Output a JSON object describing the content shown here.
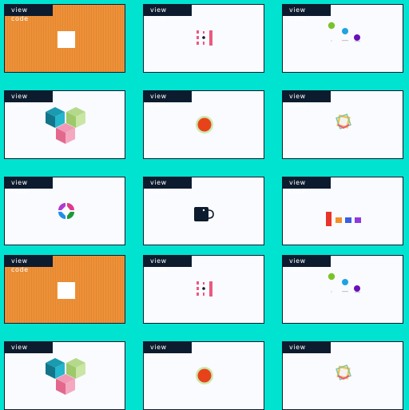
{
  "cards": [
    {
      "label": "view code",
      "art": "square-on-orange-icon",
      "background": "#ee9037"
    },
    {
      "label": "view code",
      "art": "pink-bars-icon"
    },
    {
      "label": "view code",
      "art": "bouncing-dots-icon"
    },
    {
      "label": "view code",
      "art": "cubes-icon"
    },
    {
      "label": "view code",
      "art": "pulsing-circle-icon"
    },
    {
      "label": "view code",
      "art": "rotating-square-icon"
    },
    {
      "label": "view code",
      "art": "four-circles-icon"
    },
    {
      "label": "view code",
      "art": "mug-icon"
    },
    {
      "label": "view code",
      "art": "color-blocks-icon"
    },
    {
      "label": "view code",
      "art": "square-on-orange-icon",
      "background": "#ee9037"
    },
    {
      "label": "view code",
      "art": "pink-bars-icon"
    },
    {
      "label": "view code",
      "art": "bouncing-dots-icon"
    },
    {
      "label": "view code",
      "art": "cubes-icon"
    },
    {
      "label": "view code",
      "art": "pulsing-circle-icon"
    },
    {
      "label": "view code",
      "art": "rotating-square-icon"
    }
  ],
  "colors": {
    "page_background": "#00e3d1",
    "card_background": "#fafbff",
    "label_background": "#0d1b2e",
    "orange": "#ee9037",
    "pink": "#ea5a7f",
    "red_orange": "#e8421b",
    "navy": "#0d1b2e"
  }
}
